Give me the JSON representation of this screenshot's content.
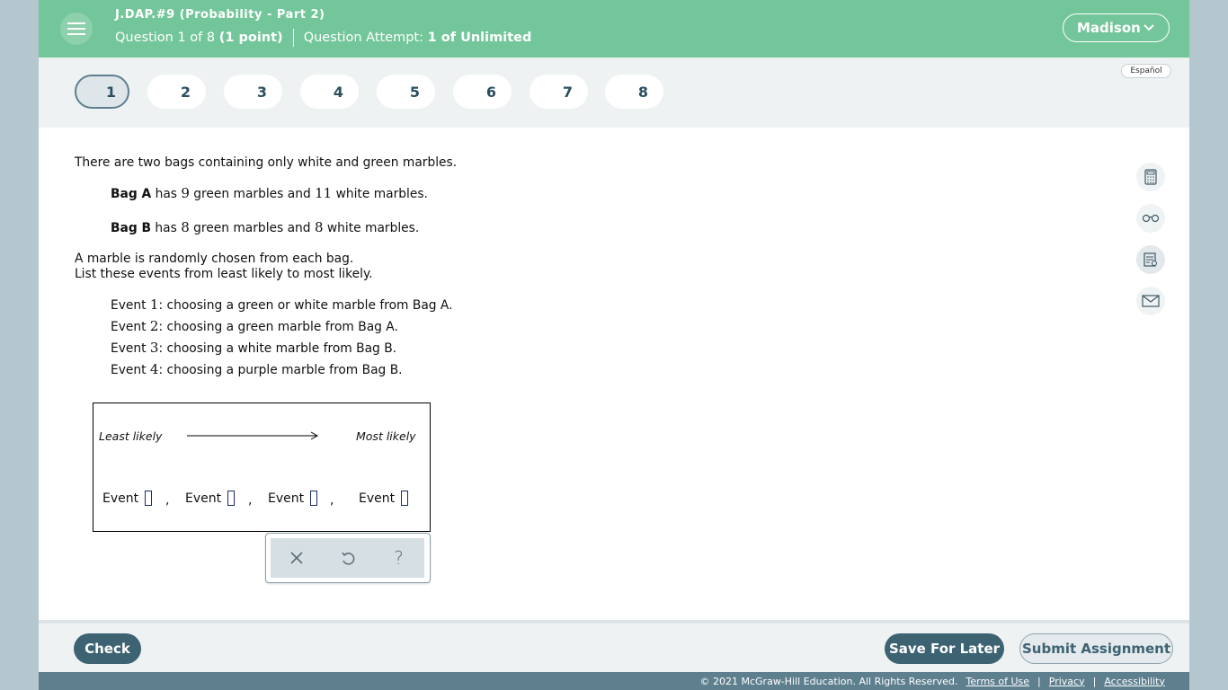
{
  "header": {
    "title": "J.DAP.#9 (Probability - Part 2)",
    "question_prefix": "Question 1 of 8",
    "question_points": "(1 point)",
    "attempt_prefix": "Question Attempt:",
    "attempt_value": "1 of Unlimited",
    "user_name": "Madison",
    "icons": {
      "menu": "hamburger-icon",
      "user_dropdown": "chevron-down-icon"
    }
  },
  "qnav": {
    "items": [
      "1",
      "2",
      "3",
      "4",
      "5",
      "6",
      "7",
      "8"
    ],
    "active": "1",
    "language_label": "Español"
  },
  "question": {
    "intro": "There are two bags containing only white and green marbles.",
    "bag_a": {
      "name": "Bag A",
      "pre": " has ",
      "green": "9",
      "mid": " green marbles and ",
      "white": "11",
      "post": " white marbles."
    },
    "bag_b": {
      "name": "Bag B",
      "pre": " has ",
      "green": "8",
      "mid": " green marbles and ",
      "white": "8",
      "post": " white marbles."
    },
    "line1": "A marble is randomly chosen from each bag.",
    "line2": "List these events from least likely to most likely.",
    "events": [
      {
        "prefix": "Event ",
        "num": "1",
        "text": ": choosing a green or white marble from Bag A."
      },
      {
        "prefix": "Event ",
        "num": "2",
        "text": ": choosing a green marble from Bag A."
      },
      {
        "prefix": "Event ",
        "num": "3",
        "text": ": choosing a white marble from Bag B."
      },
      {
        "prefix": "Event ",
        "num": "4",
        "text": ": choosing a purple marble from Bag B."
      }
    ]
  },
  "answer_box": {
    "least_label": "Least likely",
    "most_label": "Most likely",
    "slot_label": "Event",
    "separator": ",",
    "slots": [
      "",
      "",
      "",
      ""
    ]
  },
  "answer_toolbar": {
    "icons": [
      "close-icon",
      "undo-icon",
      "help-icon"
    ],
    "help_glyph": "?"
  },
  "tools": [
    "calculator-icon",
    "glasses-icon",
    "notes-icon",
    "mail-icon"
  ],
  "footer": {
    "check_label": "Check",
    "save_label": "Save For Later",
    "submit_label": "Submit Assignment",
    "copyright": "© 2021 McGraw-Hill Education. All Rights Reserved.",
    "links": [
      "Terms of Use",
      "Privacy",
      "Accessibility"
    ],
    "pipe": "|"
  }
}
